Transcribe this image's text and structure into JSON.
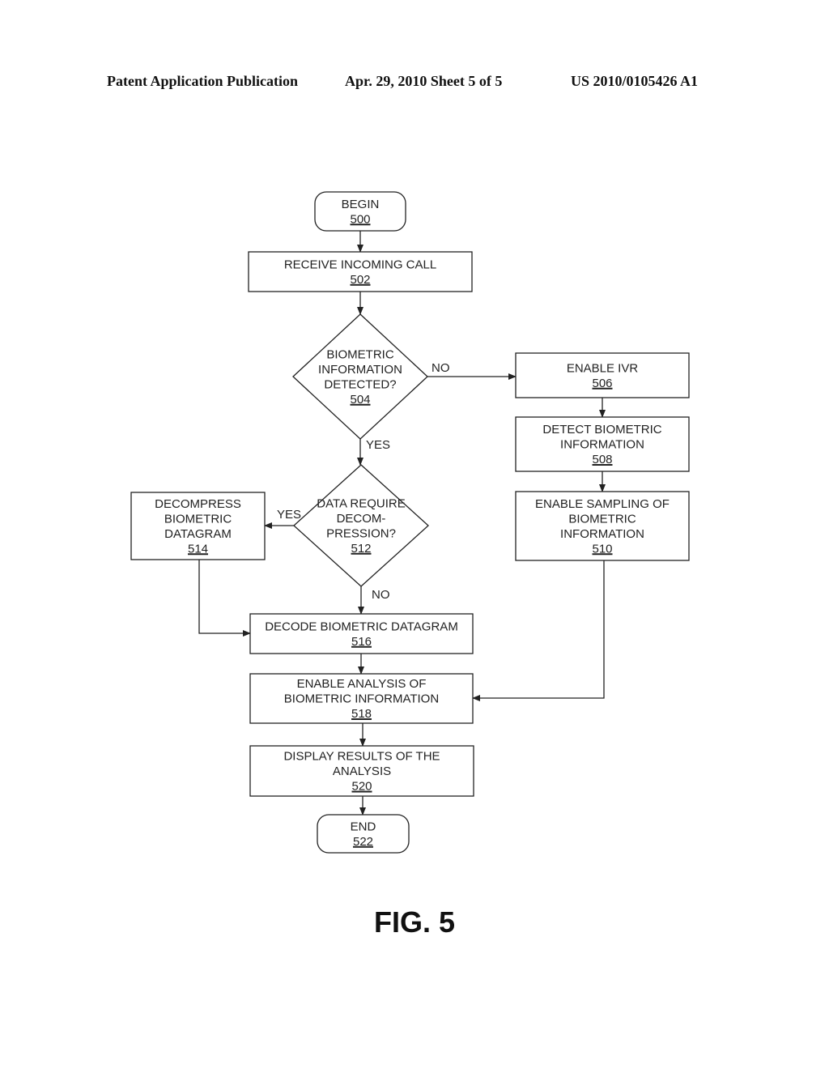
{
  "header": {
    "left": "Patent Application Publication",
    "middle": "Apr. 29, 2010  Sheet 5 of 5",
    "right": "US 2010/0105426 A1"
  },
  "figure_label": "FIG. 5",
  "nodes": [
    {
      "id": "500",
      "shape": "terminal",
      "lines": [
        "BEGIN"
      ],
      "ref": "500"
    },
    {
      "id": "502",
      "shape": "process",
      "lines": [
        "RECEIVE INCOMING CALL"
      ],
      "ref": "502"
    },
    {
      "id": "504",
      "shape": "decision",
      "lines": [
        "BIOMETRIC",
        "INFORMATION",
        "DETECTED?"
      ],
      "ref": "504"
    },
    {
      "id": "506",
      "shape": "process",
      "lines": [
        "ENABLE IVR"
      ],
      "ref": "506"
    },
    {
      "id": "508",
      "shape": "process",
      "lines": [
        "DETECT BIOMETRIC",
        "INFORMATION"
      ],
      "ref": "508"
    },
    {
      "id": "510",
      "shape": "process",
      "lines": [
        "ENABLE SAMPLING OF",
        "BIOMETRIC",
        "INFORMATION"
      ],
      "ref": "510"
    },
    {
      "id": "512",
      "shape": "decision",
      "lines": [
        "DATA REQUIRE",
        "DECOM-",
        "PRESSION?"
      ],
      "ref": "512"
    },
    {
      "id": "514",
      "shape": "process",
      "lines": [
        "DECOMPRESS",
        "BIOMETRIC",
        "DATAGRAM"
      ],
      "ref": "514"
    },
    {
      "id": "516",
      "shape": "process",
      "lines": [
        "DECODE BIOMETRIC DATAGRAM"
      ],
      "ref": "516"
    },
    {
      "id": "518",
      "shape": "process",
      "lines": [
        "ENABLE ANALYSIS OF",
        "BIOMETRIC INFORMATION"
      ],
      "ref": "518"
    },
    {
      "id": "520",
      "shape": "process",
      "lines": [
        "DISPLAY RESULTS OF THE",
        "ANALYSIS"
      ],
      "ref": "520"
    },
    {
      "id": "522",
      "shape": "terminal",
      "lines": [
        "END"
      ],
      "ref": "522"
    }
  ],
  "edges": [
    {
      "from": "500",
      "to": "502",
      "label": ""
    },
    {
      "from": "502",
      "to": "504",
      "label": ""
    },
    {
      "from": "504",
      "to": "506",
      "label": "NO"
    },
    {
      "from": "504",
      "to": "512",
      "label": "YES"
    },
    {
      "from": "506",
      "to": "508",
      "label": ""
    },
    {
      "from": "508",
      "to": "510",
      "label": ""
    },
    {
      "from": "510",
      "to": "518",
      "label": ""
    },
    {
      "from": "512",
      "to": "514",
      "label": "YES"
    },
    {
      "from": "512",
      "to": "516",
      "label": "NO"
    },
    {
      "from": "514",
      "to": "516",
      "label": ""
    },
    {
      "from": "516",
      "to": "518",
      "label": ""
    },
    {
      "from": "518",
      "to": "520",
      "label": ""
    },
    {
      "from": "520",
      "to": "522",
      "label": ""
    }
  ]
}
